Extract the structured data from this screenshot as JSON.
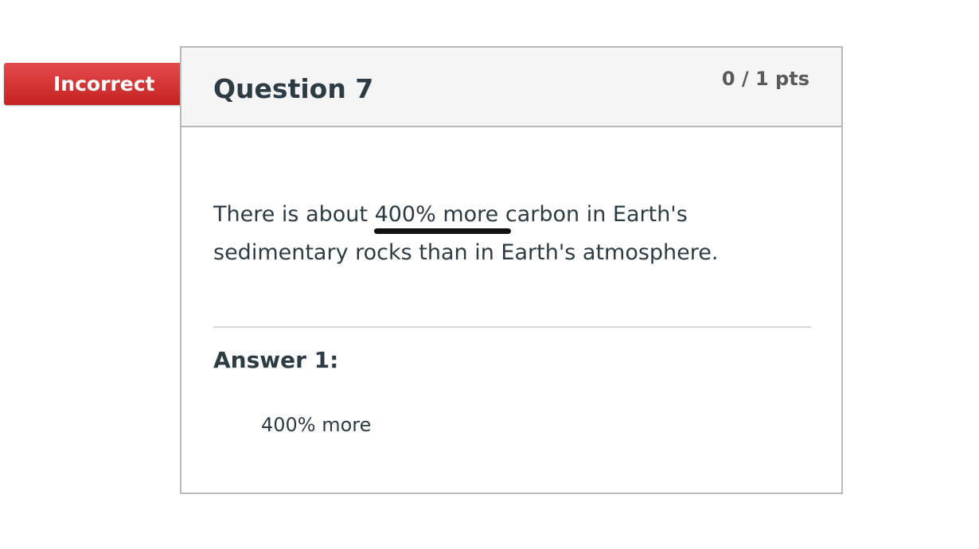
{
  "status": {
    "label": "Incorrect",
    "color": "#d43333"
  },
  "question": {
    "title": "Question 7",
    "points": "0 / 1 pts",
    "text_part1": "There is about ",
    "text_highlight": "400% more",
    "text_part2": " carbon in Earth's sedimentary rocks than in Earth's atmosphere."
  },
  "answers": [
    {
      "label": "Answer 1:",
      "value": "400% more"
    }
  ]
}
